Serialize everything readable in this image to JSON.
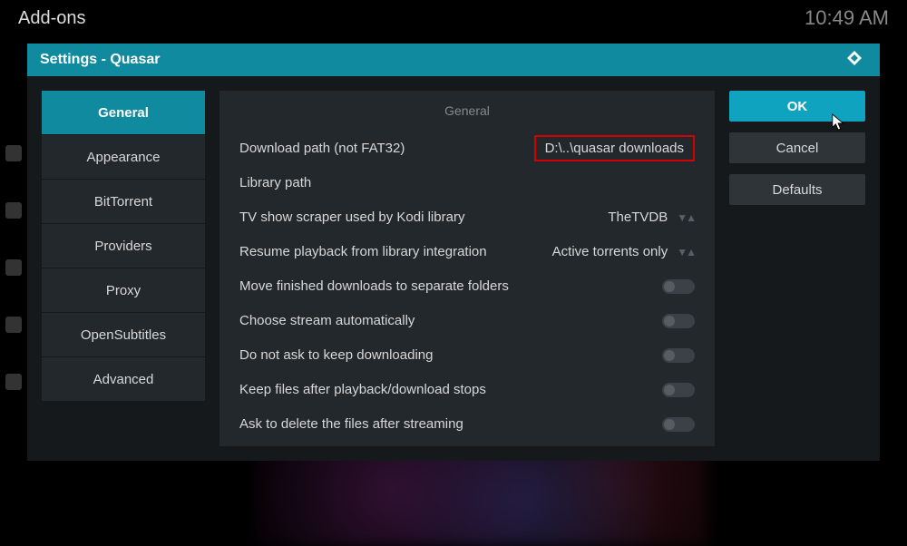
{
  "topbar": {
    "title": "Add-ons",
    "time": "10:49 AM"
  },
  "dialog": {
    "title": "Settings - Quasar"
  },
  "nav": {
    "items": [
      {
        "label": "General",
        "active": true
      },
      {
        "label": "Appearance"
      },
      {
        "label": "BitTorrent"
      },
      {
        "label": "Providers"
      },
      {
        "label": "Proxy"
      },
      {
        "label": "OpenSubtitles"
      },
      {
        "label": "Advanced"
      }
    ]
  },
  "section": {
    "heading": "General"
  },
  "settings": {
    "download_path": {
      "label": "Download path (not FAT32)",
      "value": "D:\\..\\quasar downloads"
    },
    "library_path": {
      "label": "Library path",
      "value": ""
    },
    "scraper": {
      "label": "TV show scraper used by Kodi library",
      "value": "TheTVDB"
    },
    "resume": {
      "label": "Resume playback from library integration",
      "value": "Active torrents only"
    },
    "move_finished": {
      "label": "Move finished downloads to separate folders"
    },
    "choose_stream": {
      "label": "Choose stream automatically"
    },
    "no_ask": {
      "label": "Do not ask to keep downloading"
    },
    "keep_files": {
      "label": "Keep files after playback/download stops"
    },
    "ask_delete": {
      "label": "Ask to delete the files after streaming"
    }
  },
  "actions": {
    "ok": "OK",
    "cancel": "Cancel",
    "defaults": "Defaults"
  }
}
